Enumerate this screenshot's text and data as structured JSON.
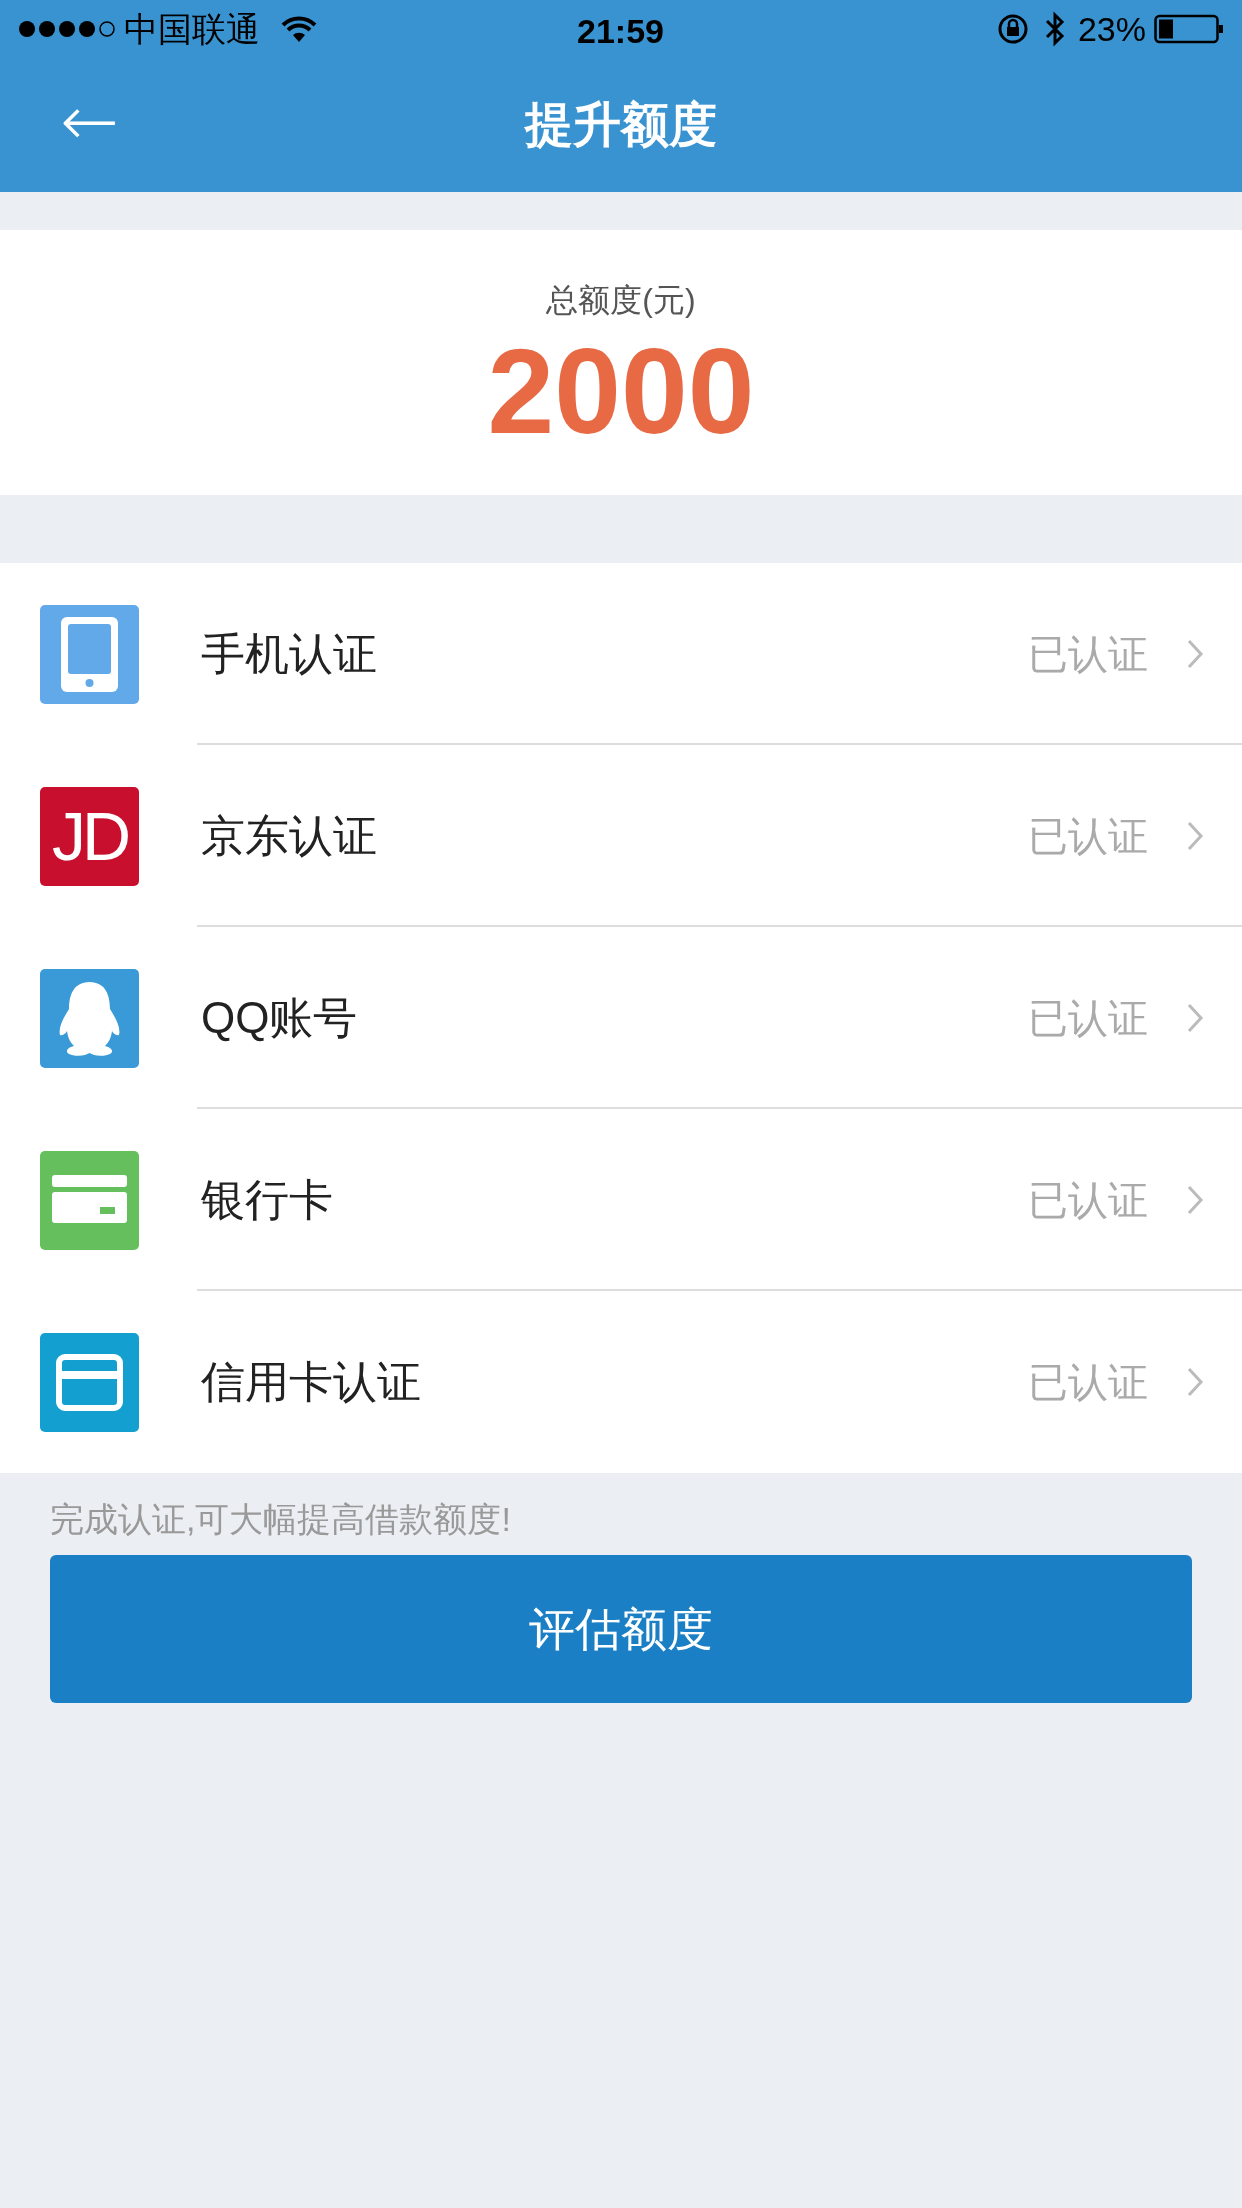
{
  "status_bar": {
    "carrier": "中国联通",
    "time": "21:59",
    "battery": "23%"
  },
  "nav": {
    "back": "←",
    "title": "提升额度"
  },
  "summary": {
    "label": "总额度(元)",
    "amount": "2000"
  },
  "items": [
    {
      "kind": "phone",
      "label": "手机认证",
      "status": "已认证"
    },
    {
      "kind": "jd",
      "logo_text": "JD",
      "label": "京东认证",
      "status": "已认证"
    },
    {
      "kind": "qq",
      "label": "QQ账号",
      "status": "已认证"
    },
    {
      "kind": "bank",
      "label": "银行卡",
      "status": "已认证"
    },
    {
      "kind": "credit",
      "label": "信用卡认证",
      "status": "已认证"
    }
  ],
  "hint": "完成认证,可大幅提高借款额度!",
  "button": "评估额度"
}
